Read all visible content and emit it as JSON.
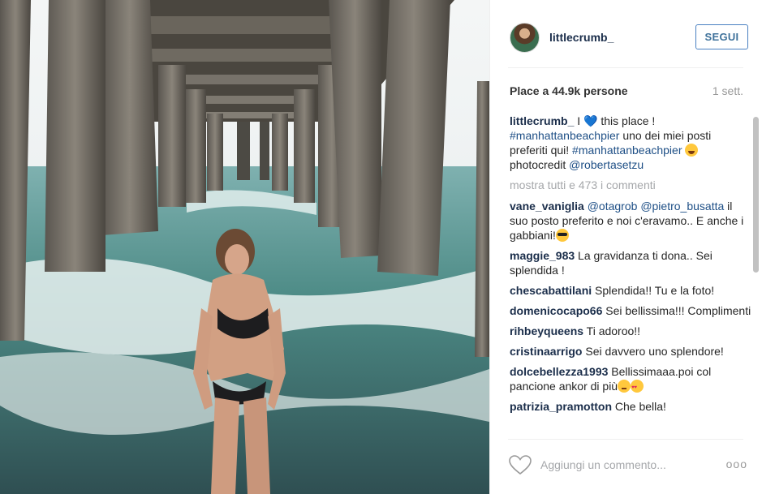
{
  "post": {
    "username": "littlecrumb_",
    "follow_label": "SEGUI",
    "likes": "Place a 44.9k persone",
    "time": "1 sett."
  },
  "caption": {
    "user": "littlecrumb_",
    "t1": " I ",
    "t2": " this place ! ",
    "tag1": "#manhattanbeachpier",
    "t3": " uno dei miei posti preferiti qui! ",
    "tag2": "#manhattanbeachpier",
    "t4": " photocredit ",
    "mention": "@robertasetzu"
  },
  "show_all": "mostra tutti e 473 i commenti",
  "comments": [
    {
      "user": "vane_vaniglia",
      "mention1": "@otagrob",
      "mention2": "@pietro_busatta",
      "text": " il suo posto preferito e noi c'eravamo.. E anche i gabbiani!"
    },
    {
      "user": "maggie_983",
      "text": " La gravidanza ti dona.. Sei splendida !"
    },
    {
      "user": "chescabattilani",
      "text": " Splendida!! Tu e la foto!"
    },
    {
      "user": "domenicocapo66",
      "text": " Sei bellissima!!! Complimenti"
    },
    {
      "user": "rihbeyqueens",
      "text": " Ti adoroo!!"
    },
    {
      "user": "cristinaarrigo",
      "text": " Sei davvero uno splendore!"
    },
    {
      "user": "dolcebellezza1993",
      "text": " Bellissimaaa.poi col pancione ankor di più"
    },
    {
      "user": "patrizia_pramotton",
      "text": " Che bella!"
    }
  ],
  "footer": {
    "placeholder": "Aggiungi un commento...",
    "more": "ooo"
  },
  "icons": {
    "heart": "heart-icon",
    "more": "more-options-icon"
  },
  "colors": {
    "link": "#1e4f86",
    "follow_border": "#4a81c2",
    "muted": "#a5a7aa"
  }
}
